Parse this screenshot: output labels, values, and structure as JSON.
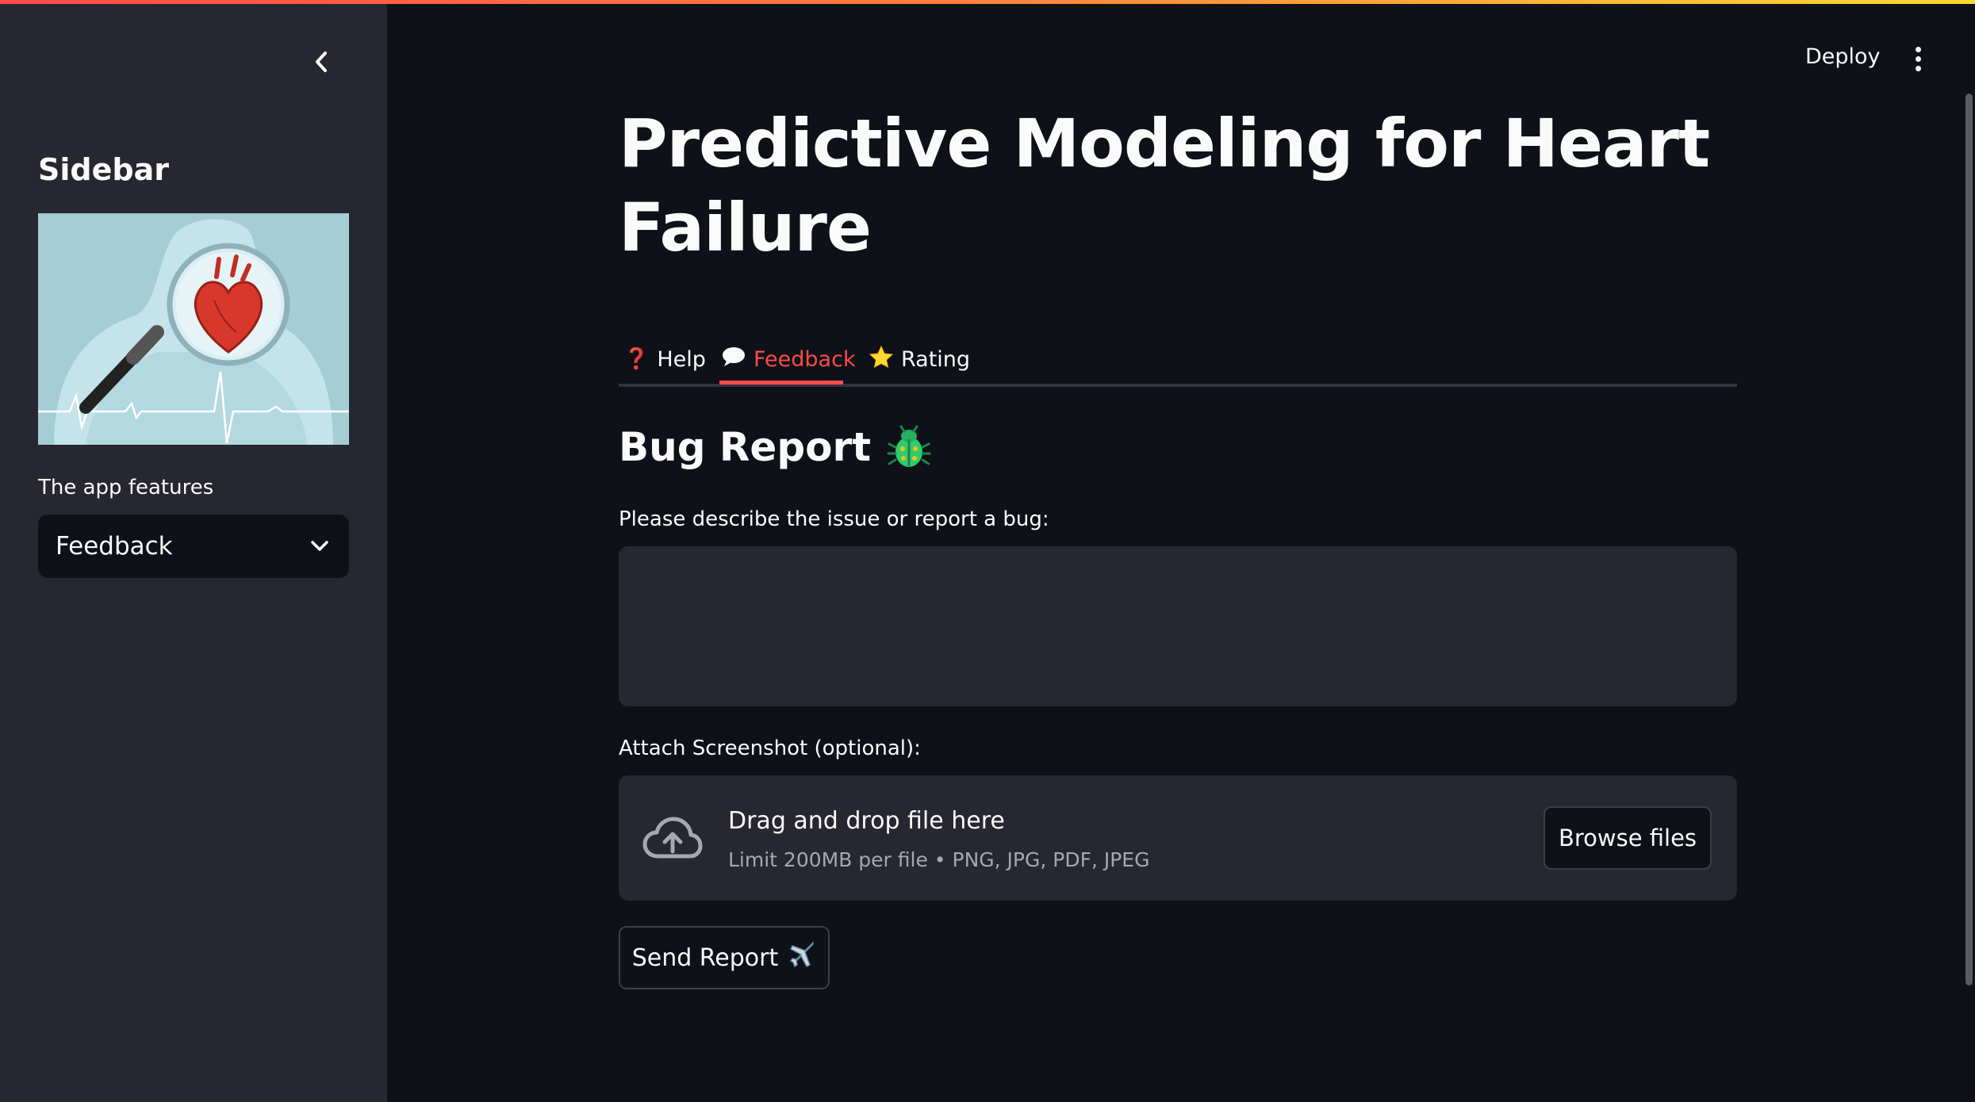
{
  "sidebar": {
    "title": "Sidebar",
    "image_alt": "heart-under-magnifying-glass",
    "select_label": "The app features",
    "select_value": "Feedback"
  },
  "header": {
    "deploy_label": "Deploy",
    "menu_icon": "kebab-menu-icon"
  },
  "main": {
    "title": "Predictive Modeling for Heart Failure",
    "tabs": [
      {
        "icon": "❓",
        "label": "Help",
        "active": false
      },
      {
        "icon": "💬",
        "label": "Feedback",
        "active": true
      },
      {
        "icon": "⭐",
        "label": "Rating",
        "active": false
      }
    ],
    "section_heading": "Bug Report",
    "section_icon": "bug-icon",
    "issue_label": "Please describe the issue or report a bug:",
    "issue_value": "",
    "attach_label": "Attach Screenshot (optional):",
    "uploader": {
      "main_text": "Drag and drop file here",
      "sub_text": "Limit 200MB per file • PNG, JPG, PDF, JPEG",
      "browse_label": "Browse files"
    },
    "send_label": "Send Report",
    "send_icon": "✈️"
  },
  "colors": {
    "background": "#0e1117",
    "sidebar": "#262730",
    "accent": "#ff4b4b"
  }
}
